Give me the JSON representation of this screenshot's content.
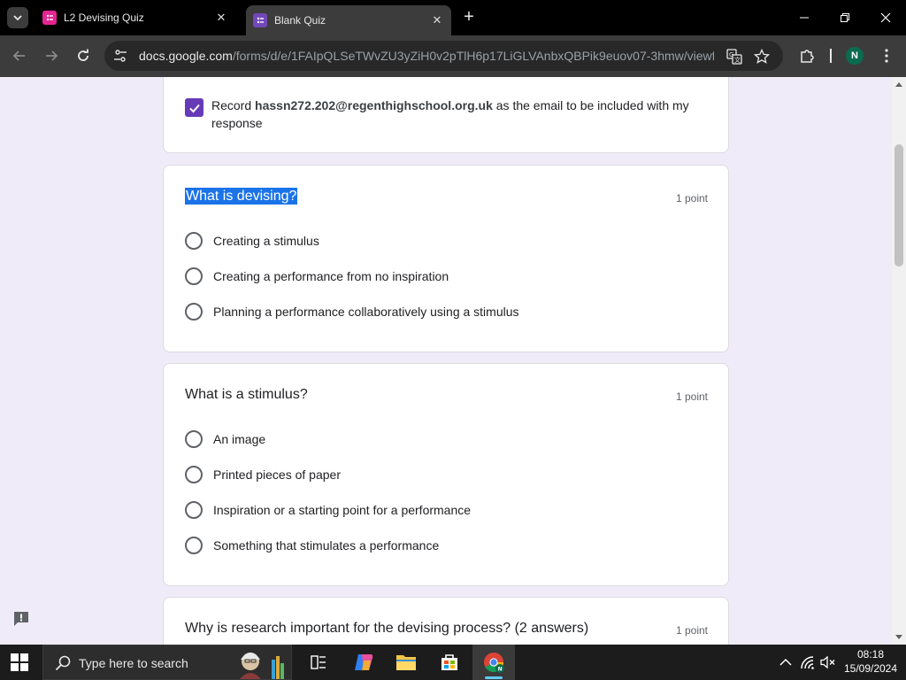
{
  "browser": {
    "tabs": [
      {
        "title": "L2 Devising Quiz",
        "active": false,
        "favicon_color": "#e52592"
      },
      {
        "title": "Blank Quiz",
        "active": true,
        "favicon_color": "#7248b9"
      }
    ],
    "url_domain": "docs.google.com",
    "url_path": "/forms/d/e/1FAIpQLSeTWvZU3yZiH0v2pTlH6p17LiGLVAnbxQBPik9euov07-3hmw/viewf...",
    "profile_initial": "N"
  },
  "form": {
    "email_record": {
      "checked": true,
      "prefix": "Record ",
      "address": "hassn272.202@regenthighschool.org.uk",
      "suffix": " as the email to be included with my response"
    },
    "questions": [
      {
        "title": "What is devising?",
        "points": "1 point",
        "selected_text": true,
        "options": [
          "Creating a stimulus",
          "Creating a performance from no inspiration",
          "Planning a performance collaboratively using a stimulus"
        ]
      },
      {
        "title": "What is a stimulus?",
        "points": "1 point",
        "options": [
          "An image",
          "Printed pieces of paper",
          "Inspiration or a starting point for a performance",
          "Something that stimulates a performance"
        ]
      },
      {
        "title": "Why is research important for the devising process? (2 answers)",
        "points": "1 point",
        "options": []
      }
    ]
  },
  "taskbar": {
    "search_placeholder": "Type here to search",
    "time": "08:18",
    "date": "15/09/2024"
  },
  "colors": {
    "accent": "#673ab7",
    "selection": "#1a73e8",
    "page_bg": "#f0ebf8"
  }
}
